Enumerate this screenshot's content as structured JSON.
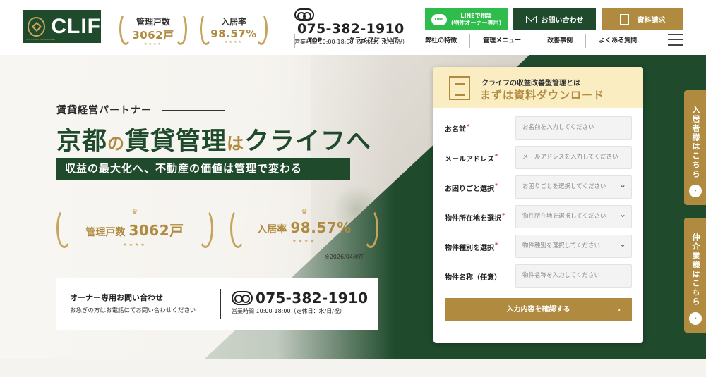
{
  "header": {
    "logo_text": "CLIF",
    "logo_sub": "CLIF ESTATE MANAGEMENT",
    "badges": [
      {
        "label": "管理戸数",
        "value": "3062戸",
        "stars": "★★★★"
      },
      {
        "label": "入居率",
        "value": "98.57%",
        "stars": "★★★★"
      }
    ],
    "phone": "075-382-1910",
    "hours": "営業時間 10:00-18:00（定休日：水/日/祝）",
    "line_icon_text": "LINE",
    "line_button": "LINEで相談\n(物件オーナー専用)",
    "line_button_l1": "LINEで相談",
    "line_button_l2": "(物件オーナー専用)",
    "contact_button": "お問い合わせ",
    "doc_button": "資料請求",
    "nav": [
      "TOP",
      "クライフについて",
      "弊社の特徴",
      "管理メニュー",
      "改善事例",
      "よくある質問"
    ]
  },
  "hero": {
    "tagline": "賃貸経営パートナー",
    "title_parts": [
      "京都",
      "の",
      "賃貸管理",
      "は",
      "クライフへ"
    ],
    "sub_banner": "収益の最大化へ、不動産の価値は管理で変わる",
    "badges": [
      {
        "label": "管理戸数",
        "value": "3062戸",
        "stars": "★★★★"
      },
      {
        "label": "入居率",
        "value": "98.57%",
        "stars": "★★★★"
      }
    ],
    "as_of": "※2026/04現在",
    "owner_title": "オーナー専用お問い合わせ",
    "owner_sub": "お急ぎの方はお電話にてお問い合わせください",
    "owner_phone": "075-382-1910",
    "owner_hours": "営業時間 10:00-18:00（定休日：水/日/祝）"
  },
  "form": {
    "head_line1": "クライフの収益改善型管理とは",
    "head_line2": "まずは資料ダウンロード",
    "fields": [
      {
        "label": "お名前",
        "required": true,
        "placeholder": "お名前を入力してください",
        "type": "text"
      },
      {
        "label": "メールアドレス",
        "required": true,
        "placeholder": "メールアドレスを入力してください",
        "type": "text"
      },
      {
        "label": "お困りごと選択",
        "required": true,
        "placeholder": "お困りごとを選択してください",
        "type": "select"
      },
      {
        "label": "物件所在地を選択",
        "required": true,
        "placeholder": "物件所在地を選択してください",
        "type": "select"
      },
      {
        "label": "物件種別を選択",
        "required": true,
        "placeholder": "物件種別を選択してください",
        "type": "select"
      },
      {
        "label": "物件名称（任意）",
        "required": false,
        "placeholder": "物件名称を入力してください",
        "type": "text"
      }
    ],
    "required_mark": "*",
    "submit": "入力内容を確認する",
    "submit_chevron": "›"
  },
  "side_tabs": [
    {
      "label": "入居者様はこちら",
      "chevron": "›"
    },
    {
      "label": "仲介業様はこちら",
      "chevron": "›"
    }
  ],
  "colors": {
    "green": "#1f4a2c",
    "gold": "#b08a3e",
    "line_green": "#2ebd4c",
    "cream": "#fbedc2"
  }
}
